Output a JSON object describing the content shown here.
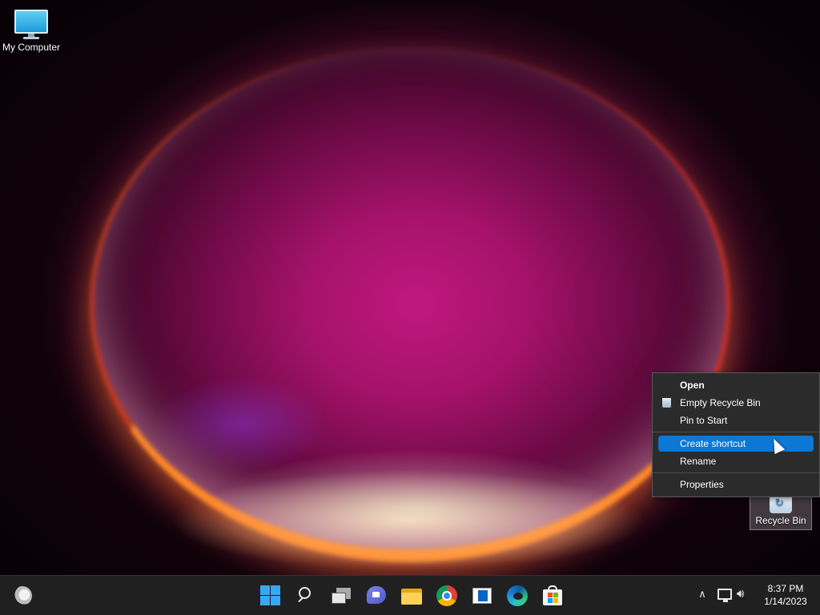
{
  "desktop": {
    "icons": [
      {
        "label": "My Computer",
        "icon": "computer-icon"
      },
      {
        "label": "Recycle Bin",
        "icon": "recycle-bin-icon",
        "selected": true
      }
    ]
  },
  "context_menu": {
    "items": [
      {
        "label": "Open",
        "bold": true
      },
      {
        "label": "Empty Recycle Bin",
        "icon": "recycle-bin-icon"
      },
      {
        "label": "Pin to Start"
      },
      {
        "label": "Create shortcut",
        "highlighted": true
      },
      {
        "label": "Rename"
      },
      {
        "label": "Properties"
      }
    ],
    "highlight_color": "#0a78d4"
  },
  "taskbar": {
    "apps": [
      {
        "icon": "start-icon"
      },
      {
        "icon": "search-icon"
      },
      {
        "icon": "task-view-icon"
      },
      {
        "icon": "chat-icon"
      },
      {
        "icon": "file-explorer-icon"
      },
      {
        "icon": "chrome-icon"
      },
      {
        "icon": "notepad-icon"
      },
      {
        "icon": "edge-icon"
      },
      {
        "icon": "microsoft-store-icon"
      }
    ],
    "tray": {
      "icons": [
        "chevron-up-icon",
        "network-icon",
        "volume-icon"
      ],
      "time": "8:37 PM",
      "date": "1/14/2023"
    },
    "widgets_icon": "weather-icon"
  }
}
